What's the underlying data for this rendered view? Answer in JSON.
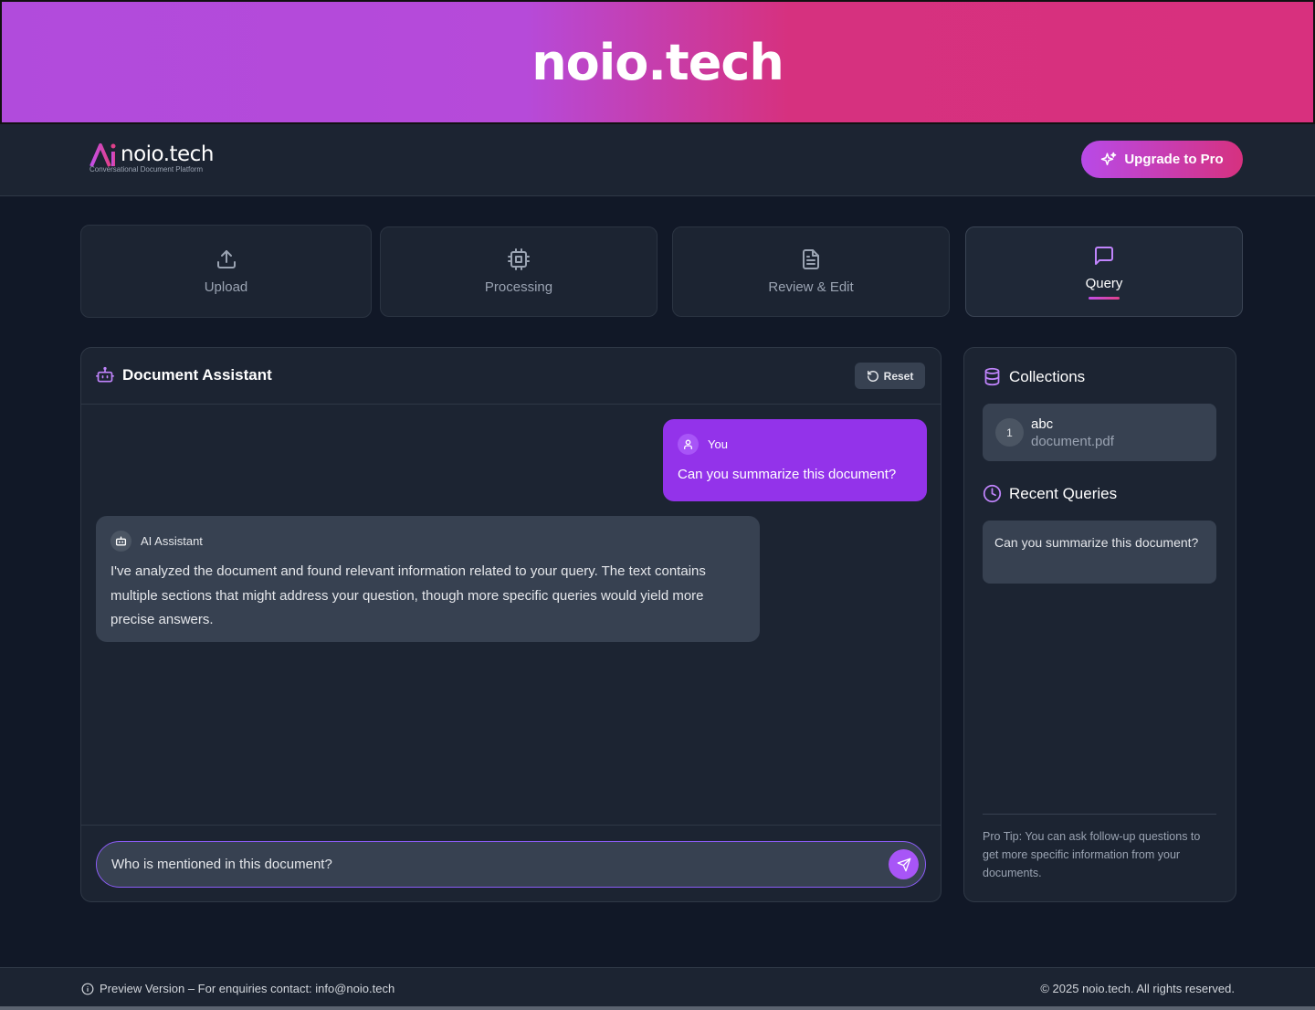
{
  "banner": {
    "title": "noio.tech"
  },
  "header": {
    "logo_text": "noio.tech",
    "logo_subtitle": "Conversational Document Platform",
    "upgrade_label": "Upgrade to Pro"
  },
  "steps": [
    {
      "label": "Upload",
      "icon": "upload-icon",
      "active": false
    },
    {
      "label": "Processing",
      "icon": "cpu-icon",
      "active": false
    },
    {
      "label": "Review & Edit",
      "icon": "document-icon",
      "active": false
    },
    {
      "label": "Query",
      "icon": "chat-bubble-icon",
      "active": true
    }
  ],
  "chat": {
    "title": "Document Assistant",
    "reset_label": "Reset",
    "messages": [
      {
        "role": "user",
        "author": "You",
        "text": "Can you summarize this document?"
      },
      {
        "role": "assistant",
        "author": "AI Assistant",
        "text": "I've analyzed the document and found relevant information related to your query. The text contains multiple sections that might address your question, though more specific queries would yield more precise answers."
      }
    ],
    "input_value": "Who is mentioned in this document?"
  },
  "sidebar": {
    "collections_title": "Collections",
    "collections": [
      {
        "number": "1",
        "name": "abc",
        "file": "document.pdf"
      }
    ],
    "recent_title": "Recent Queries",
    "recent_queries": [
      {
        "text": "Can you summarize this document?"
      }
    ],
    "pro_tip": "Pro Tip: You can ask follow-up questions to get more specific information from your documents."
  },
  "footer": {
    "left_text": "Preview Version – For enquiries contact: info@noio.tech",
    "right_text": "© 2025 noio.tech. All rights reserved."
  },
  "colors": {
    "accent": "#9333ea",
    "accent_light": "#a855f7",
    "brand_pink": "#d6317f",
    "background": "#111827",
    "panel": "#1c2432"
  }
}
